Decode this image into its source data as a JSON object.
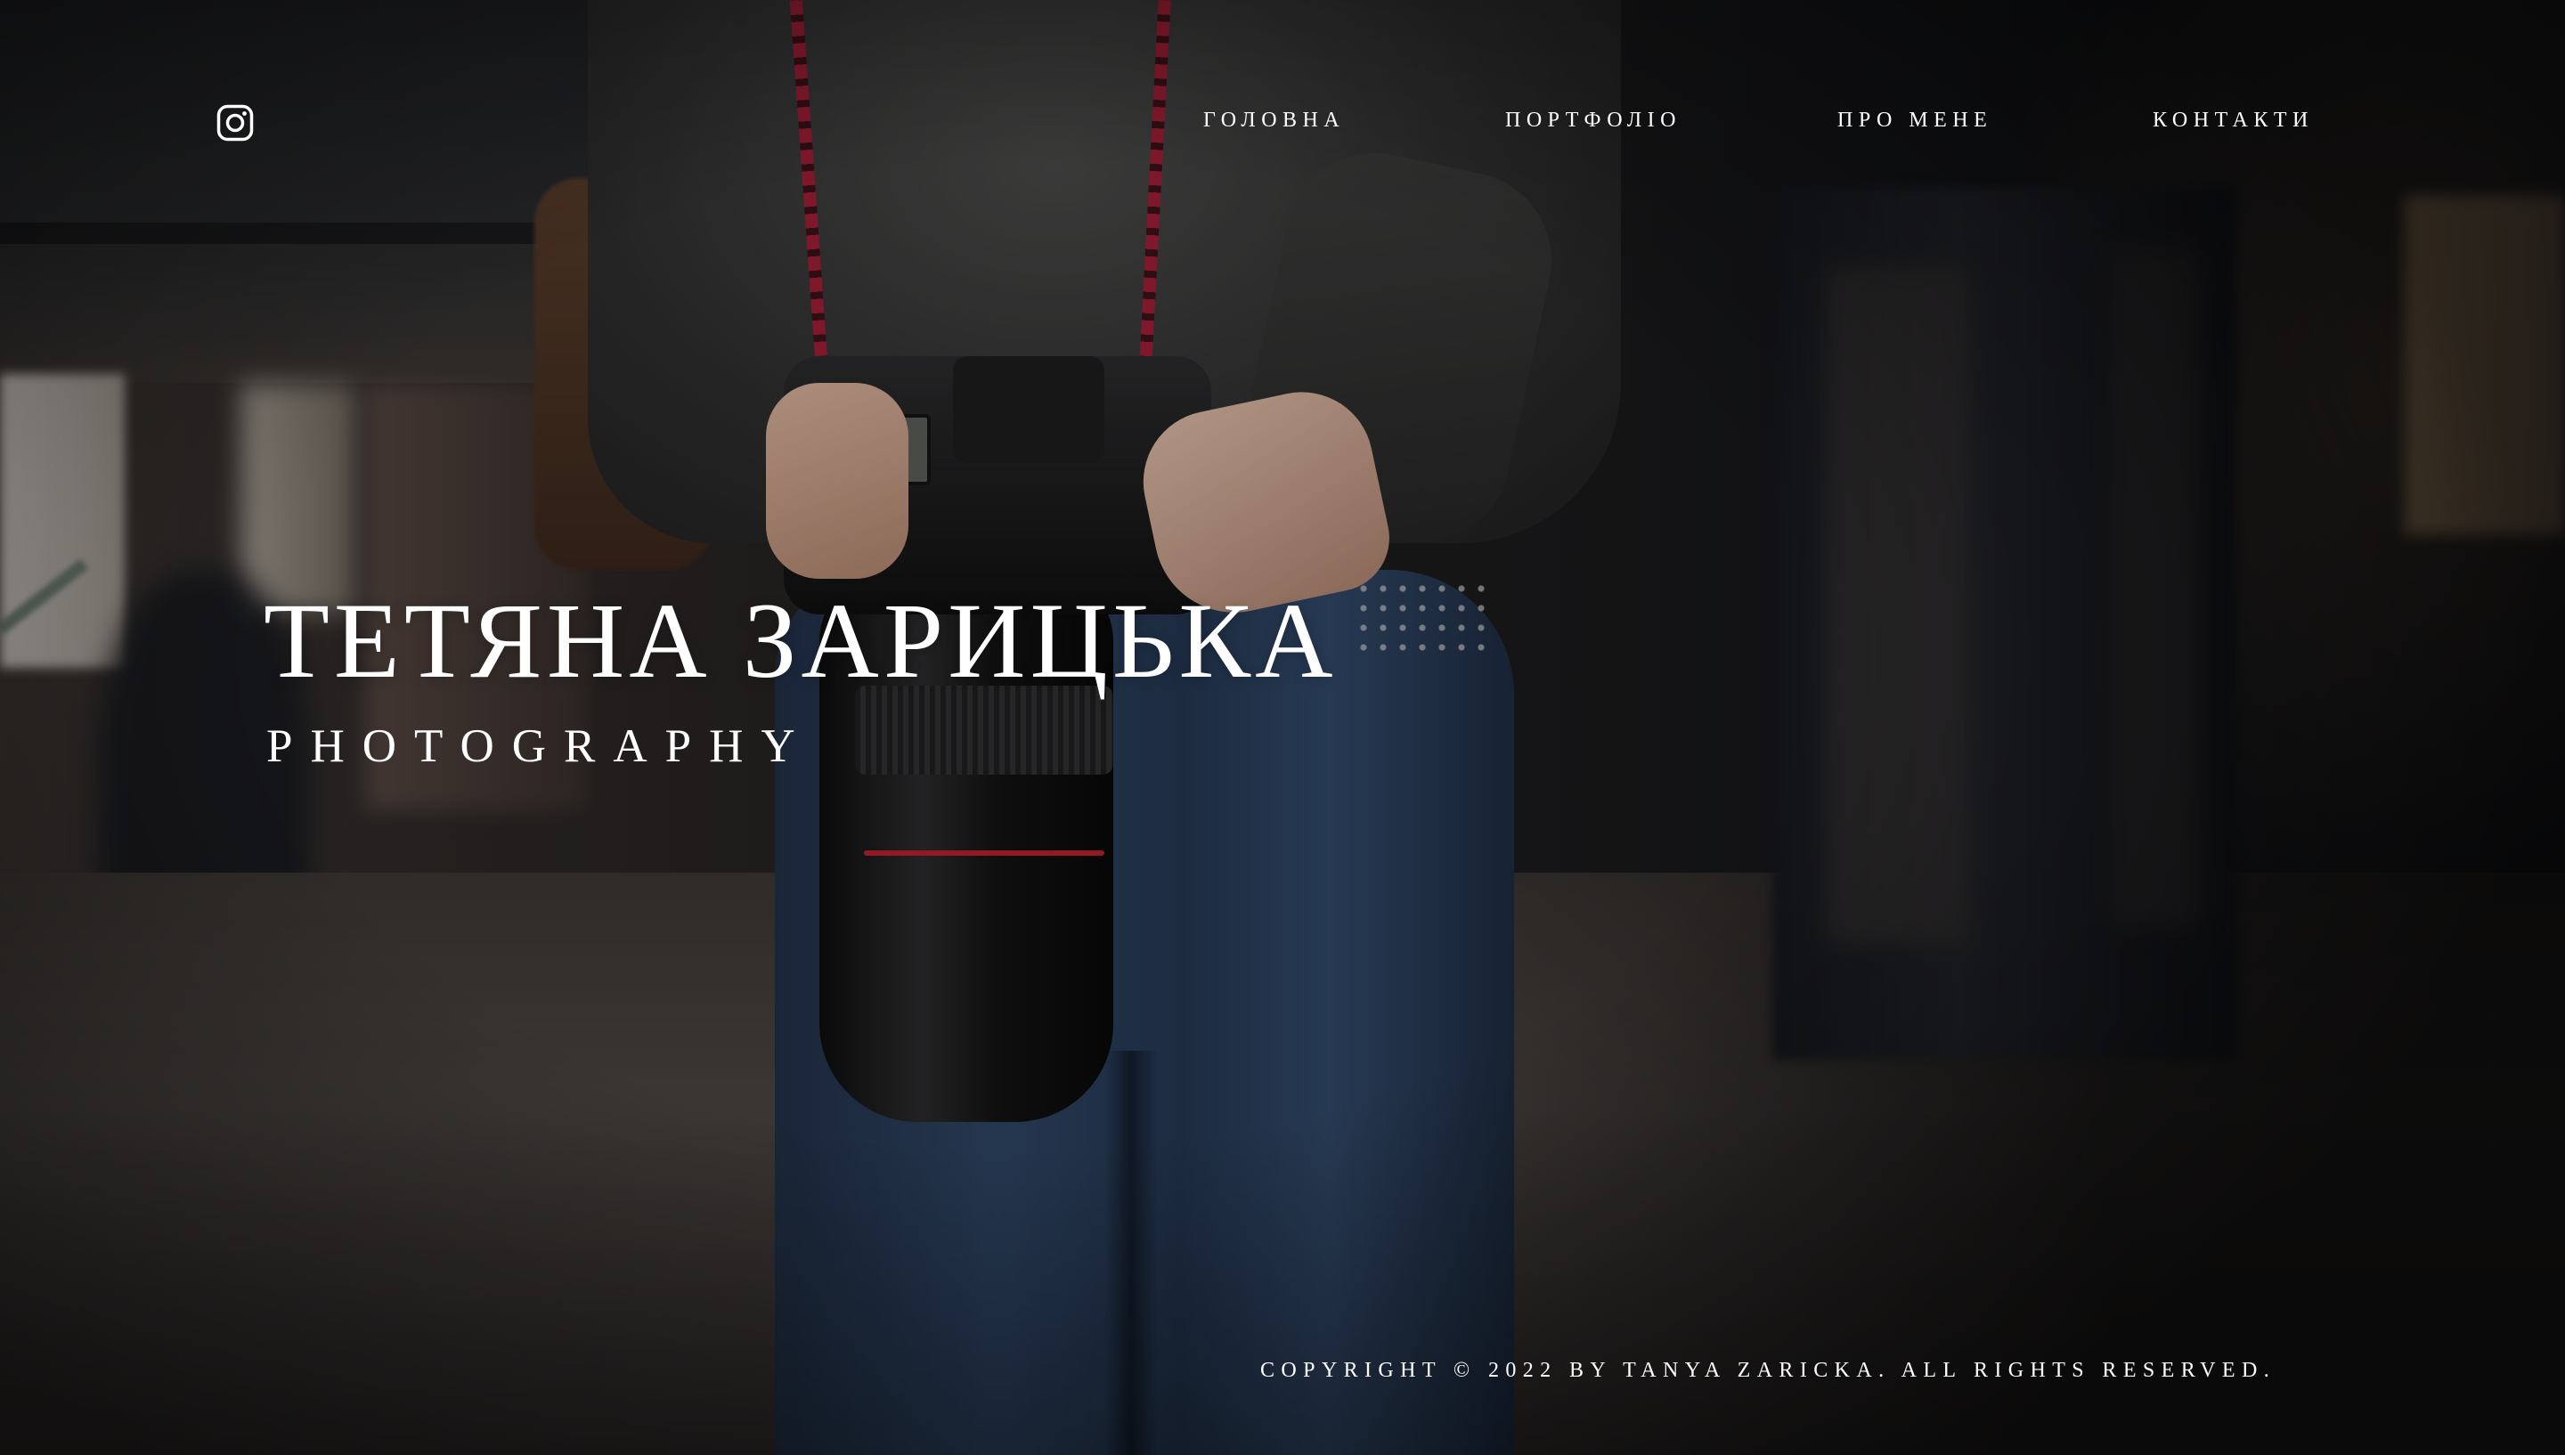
{
  "header": {
    "social": {
      "icon": "instagram-icon"
    },
    "nav": [
      {
        "label": "ГОЛОВНА"
      },
      {
        "label": "ПОРТФОЛІО"
      },
      {
        "label": "ПРО МЕНЕ"
      },
      {
        "label": "КОНТАКТИ"
      }
    ]
  },
  "hero": {
    "title": "ТЕТЯНА ЗАРИЦЬКА",
    "subtitle": "PHOTOGRAPHY",
    "background_image": "photographer-with-camera"
  },
  "footer": {
    "copyright": "COPYRIGHT © 2022 BY TANYA ZARICKA. ALL RIGHTS RESERVED."
  },
  "colors": {
    "text": "#ffffff",
    "background": "#1a1716"
  }
}
